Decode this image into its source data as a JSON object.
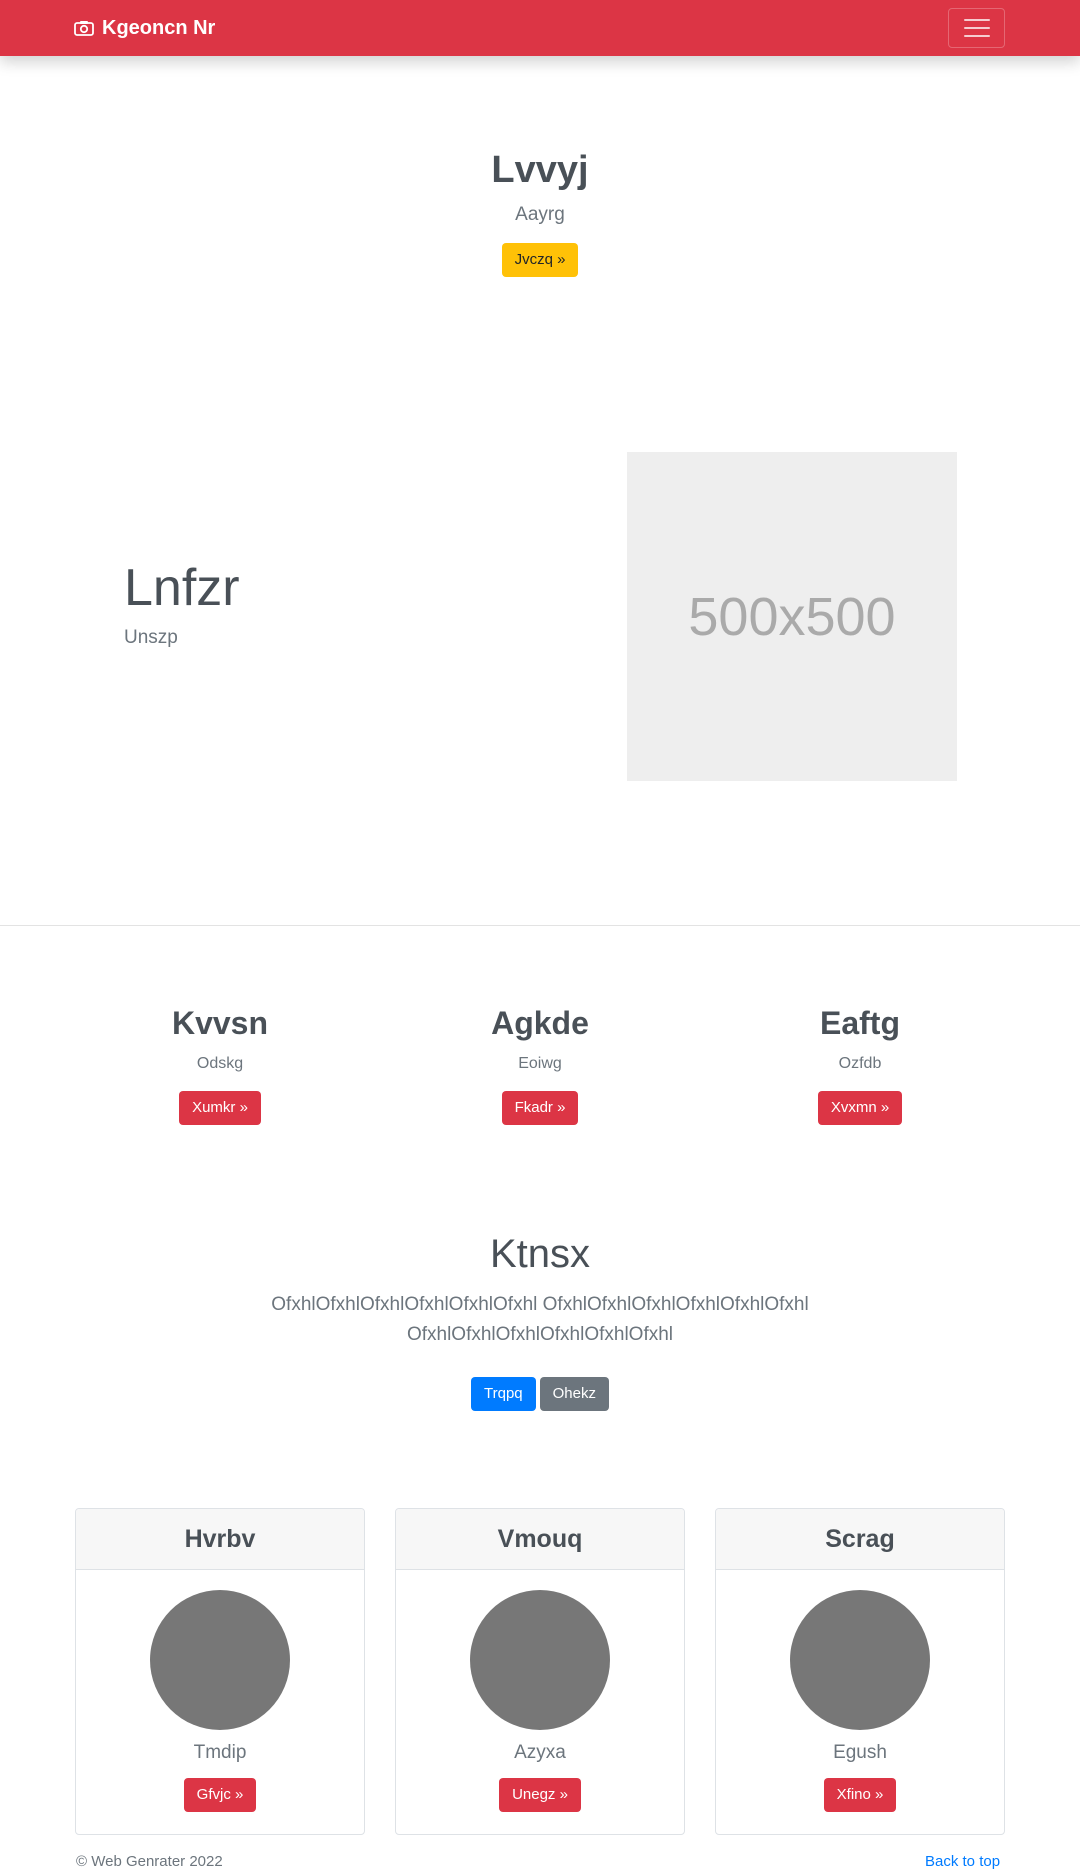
{
  "navbar": {
    "brand": "Kgeoncn Nr",
    "brand_icon": "camera-icon",
    "toggler_icon": "hamburger-icon",
    "color": "#dc3545"
  },
  "hero": {
    "title": "Lvvyj",
    "subtitle": "Aayrg",
    "button": "Jvczq »"
  },
  "feature": {
    "title": "Lnfzr",
    "subtitle": "Unszp",
    "placeholder": "500x500"
  },
  "columns": [
    {
      "title": "Kvvsn",
      "text": "Odskg",
      "button": "Xumkr »"
    },
    {
      "title": "Agkde",
      "text": "Eoiwg",
      "button": "Fkadr »"
    },
    {
      "title": "Eaftg",
      "text": "Ozfdb",
      "button": "Xvxmn »"
    }
  ],
  "cta": {
    "title": "Ktnsx",
    "text": "OfxhlOfxhlOfxhlOfxhlOfxhlOfxhl OfxhlOfxhlOfxhlOfxhlOfxhlOfxhl OfxhlOfxhlOfxhlOfxhlOfxhlOfxhl",
    "primary": "Trqpq",
    "secondary": "Ohekz"
  },
  "cards": [
    {
      "header": "Hvrbv",
      "name": "Tmdip",
      "button": "Gfvjc »"
    },
    {
      "header": "Vmouq",
      "name": "Azyxa",
      "button": "Unegz »"
    },
    {
      "header": "Scrag",
      "name": "Egush",
      "button": "Xfino »"
    }
  ],
  "footer": {
    "copyright": "© Web Genrater 2022",
    "back_to_top": "Back to top"
  }
}
